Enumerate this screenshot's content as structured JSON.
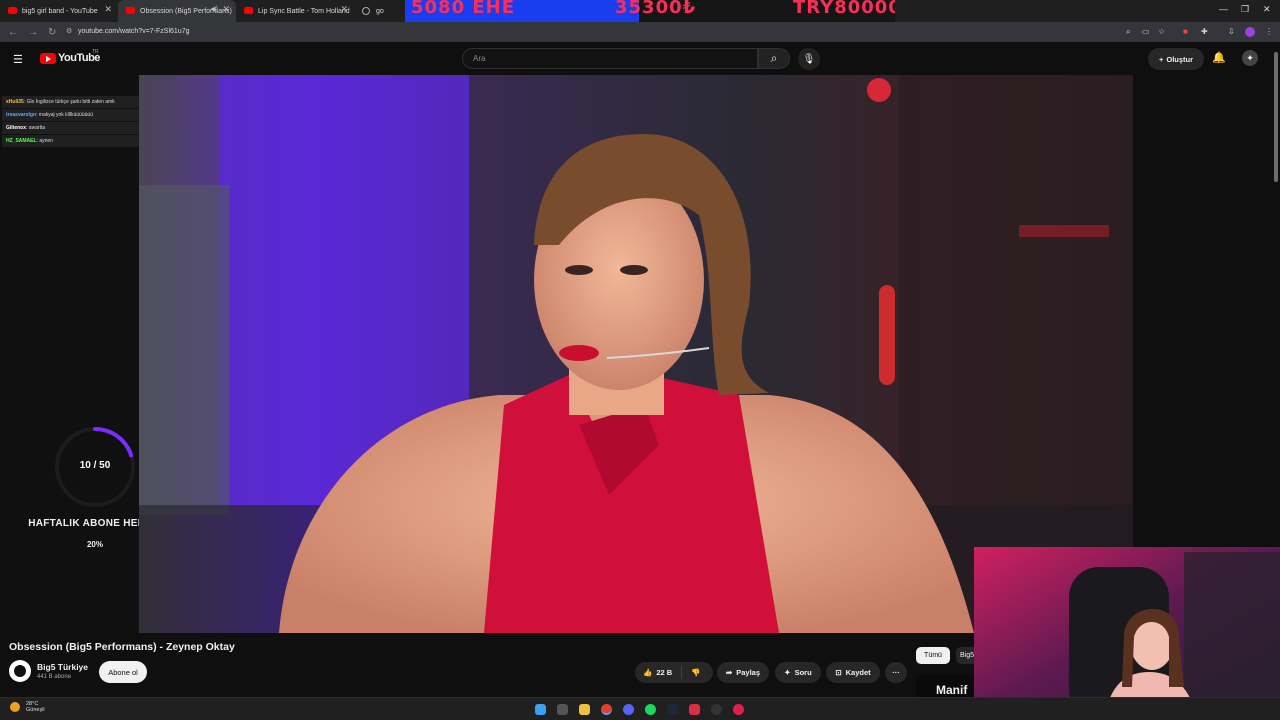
{
  "tabs": [
    {
      "label": "big5 girl band - YouTube",
      "active": false
    },
    {
      "label": "Obsession (Big5 Performans)",
      "active": true
    },
    {
      "label": "Lip Sync Battle - Tom Holland",
      "active": false
    },
    {
      "label": "golli",
      "active": false
    }
  ],
  "overlay_ticker": {
    "left": "5080 EHE",
    "mid": "35300₺",
    "right": "TRY80000"
  },
  "address": {
    "url": "youtube.com/watch?v=7-FzSl61u7g"
  },
  "header": {
    "logo": "YouTube",
    "region": "TR",
    "search_placeholder": "Ara",
    "create_label": "Oluştur"
  },
  "chat": [
    {
      "user": "xHuli35",
      "user_color": "#f7c24a",
      "message": "Glo İngilizce türkçe şarkı bitti zaten amk"
    },
    {
      "user": "treasvarolgn",
      "user_color": "#5ab0ff",
      "message": "makyaj yok kllllıüüüüüüü"
    },
    {
      "user": "Giltenox",
      "user_color": "#ffffff",
      "message": "awartta"
    },
    {
      "user": "HZ_SAMAEL",
      "user_color": "#5cff5c",
      "message": "aynen"
    }
  ],
  "goal": {
    "count": "10 / 50",
    "title": "HAFTALIK ABONE HEDEFI",
    "percent": "20%",
    "progress": 0.2,
    "ring_color": "#7b2cff"
  },
  "video": {
    "title": "Obsession (Big5 Performans) - Zeynep Oktay",
    "channel": "Big5 Türkiye",
    "subscribers": "441 B abone",
    "subscribe_label": "Abone ol",
    "likes": "22 B",
    "share_label": "Paylaş",
    "ask_label": "Soru",
    "save_label": "Kaydet",
    "more_label": "···"
  },
  "chips": {
    "all": "Tümü",
    "second": "Big5"
  },
  "rec_partial": "Manif",
  "taskbar": {
    "temp": "28°C",
    "condition": "Güneşli"
  },
  "colors": {
    "youtube_red": "#ff0000",
    "accent_purple": "#7b2cff",
    "dress_red": "#d0103a"
  }
}
